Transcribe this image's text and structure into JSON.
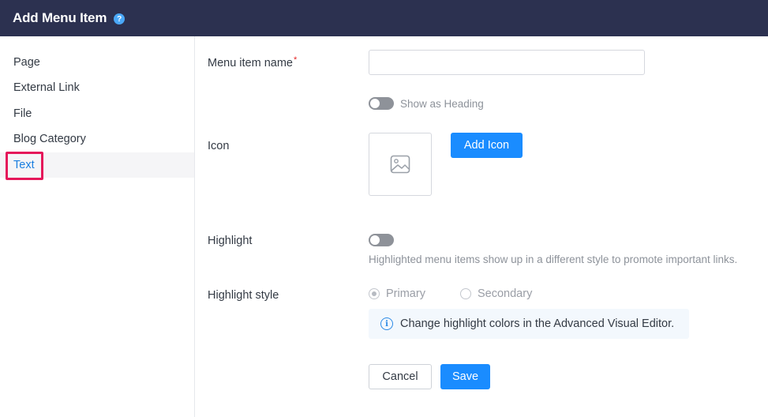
{
  "header": {
    "title": "Add Menu Item",
    "help_icon": "?"
  },
  "sidebar": {
    "items": [
      {
        "label": "Page"
      },
      {
        "label": "External Link"
      },
      {
        "label": "File"
      },
      {
        "label": "Blog Category"
      },
      {
        "label": "Text",
        "active": true
      }
    ]
  },
  "form": {
    "menu_item_name": {
      "label": "Menu item name",
      "required_mark": "*",
      "value": "",
      "placeholder": ""
    },
    "show_as_heading": {
      "label": "Show as Heading",
      "on": false
    },
    "icon": {
      "label": "Icon",
      "placeholder_icon": "image-icon",
      "add_button": "Add Icon"
    },
    "highlight": {
      "label": "Highlight",
      "on": false,
      "hint": "Highlighted menu items show up in a different style to promote important links."
    },
    "highlight_style": {
      "label": "Highlight style",
      "options": [
        {
          "label": "Primary",
          "checked": true
        },
        {
          "label": "Secondary",
          "checked": false
        }
      ],
      "info_icon": "i",
      "info": "Change highlight colors in the Advanced Visual Editor."
    },
    "cancel_label": "Cancel",
    "save_label": "Save"
  },
  "colors": {
    "header_bg": "#2c3150",
    "accent": "#1a8cff",
    "active_link": "#1b7fe0",
    "highlight_outline": "#e5175a"
  }
}
